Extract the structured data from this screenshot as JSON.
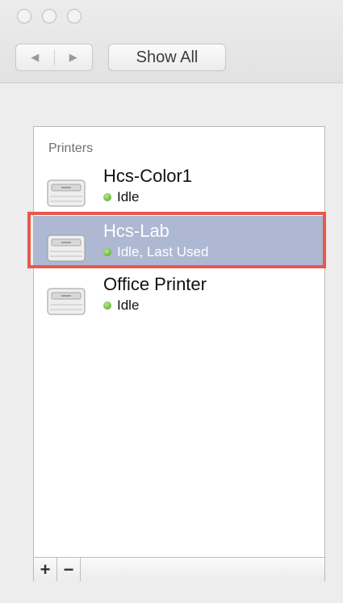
{
  "window": {
    "traffic_lights": [
      "close",
      "minimize",
      "zoom"
    ]
  },
  "toolbar": {
    "back_icon": "back-arrow-icon",
    "back_glyph": "◀",
    "forward_icon": "forward-arrow-icon",
    "forward_glyph": "▶",
    "show_all_label": "Show All"
  },
  "printers_panel": {
    "section_label": "Printers",
    "items": [
      {
        "name": "Hcs-Color1",
        "status": "Idle",
        "selected": false
      },
      {
        "name": "Hcs-Lab",
        "status": "Idle, Last Used",
        "selected": true
      },
      {
        "name": "Office Printer",
        "status": "Idle",
        "selected": false
      }
    ],
    "highlight_color": "#e8584a",
    "selection_color": "#aeb8d3",
    "status_color": "#5fbf2a"
  },
  "bottom_bar": {
    "add_label": "+",
    "remove_label": "−"
  }
}
